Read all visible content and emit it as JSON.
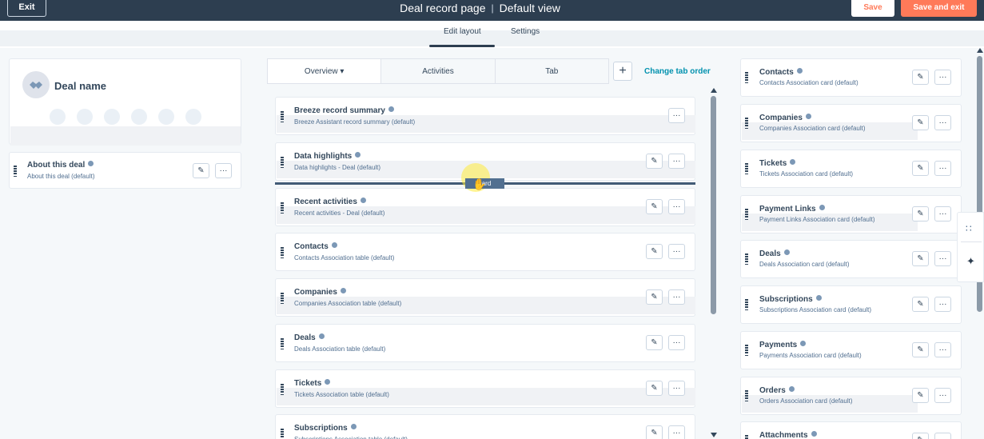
{
  "header": {
    "exit_label": "Exit",
    "title": "Deal record page",
    "view_name": "Default view",
    "save_label": "Save",
    "save_exit_label": "Save and exit"
  },
  "subnav": {
    "edit_layout": "Edit layout",
    "settings": "Settings"
  },
  "left": {
    "deal_name": "Deal name",
    "about_title": "About this deal",
    "about_sub": "About this deal (default)"
  },
  "tabs": {
    "overview": "Overview ▾",
    "activities": "Activities",
    "tab": "Tab",
    "change_order": "Change tab order"
  },
  "middle_cards": [
    {
      "title": "Breeze record summary",
      "sub": "Breeze Assistant record summary (default)"
    },
    {
      "title": "Data highlights",
      "sub": "Data highlights - Deal (default)"
    },
    {
      "title": "Recent activities",
      "sub": "Recent activities - Deal (default)"
    },
    {
      "title": "Contacts",
      "sub": "Contacts Association table (default)"
    },
    {
      "title": "Companies",
      "sub": "Companies Association table (default)"
    },
    {
      "title": "Deals",
      "sub": "Deals Association table (default)"
    },
    {
      "title": "Tickets",
      "sub": "Tickets Association table (default)"
    },
    {
      "title": "Subscriptions",
      "sub": "Subscriptions Association table (default)"
    }
  ],
  "drag_label": "card",
  "right_cards": [
    {
      "title": "Contacts",
      "sub": "Contacts Association card (default)"
    },
    {
      "title": "Companies",
      "sub": "Companies Association card (default)"
    },
    {
      "title": "Tickets",
      "sub": "Tickets Association card (default)"
    },
    {
      "title": "Payment Links",
      "sub": "Payment Links Association card (default)"
    },
    {
      "title": "Deals",
      "sub": "Deals Association card (default)"
    },
    {
      "title": "Subscriptions",
      "sub": "Subscriptions Association card (default)"
    },
    {
      "title": "Payments",
      "sub": "Payments Association card (default)"
    },
    {
      "title": "Orders",
      "sub": "Orders Association card (default)"
    },
    {
      "title": "Attachments",
      "sub": ""
    }
  ],
  "icons": {
    "edit": "✎",
    "more": "···",
    "plus": "+",
    "sparkle": "✦",
    "grid": "∷"
  }
}
